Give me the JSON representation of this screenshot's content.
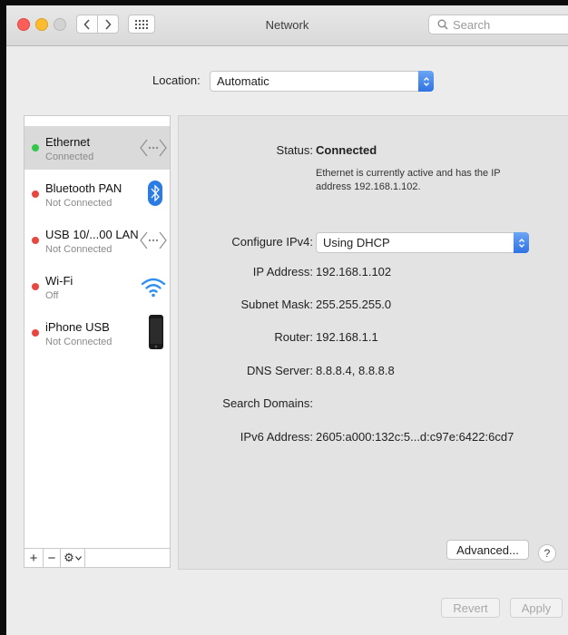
{
  "window": {
    "title": "Network"
  },
  "toolbar": {
    "search_placeholder": "Search"
  },
  "location": {
    "label": "Location:",
    "value": "Automatic"
  },
  "services": [
    {
      "name": "Ethernet",
      "status": "Connected",
      "dot": "green",
      "icon": "ethernet-icon",
      "selected": true
    },
    {
      "name": "Bluetooth PAN",
      "status": "Not Connected",
      "dot": "red",
      "icon": "bluetooth-icon",
      "selected": false
    },
    {
      "name": "USB 10/...00 LAN",
      "status": "Not Connected",
      "dot": "red",
      "icon": "usb-lan-icon",
      "selected": false
    },
    {
      "name": "Wi-Fi",
      "status": "Off",
      "dot": "red",
      "icon": "wifi-icon",
      "selected": false
    },
    {
      "name": "iPhone USB",
      "status": "Not Connected",
      "dot": "red",
      "icon": "iphone-icon",
      "selected": false
    }
  ],
  "sidebar_toolbar": {
    "add": "+",
    "remove": "−",
    "action": "⚙"
  },
  "details": {
    "status_label": "Status:",
    "status_value": "Connected",
    "status_description": "Ethernet is currently active and has the IP address 192.168.1.102.",
    "configure_label": "Configure IPv4:",
    "configure_value": "Using DHCP",
    "ip_label": "IP Address:",
    "ip_value": "192.168.1.102",
    "subnet_label": "Subnet Mask:",
    "subnet_value": "255.255.255.0",
    "router_label": "Router:",
    "router_value": "192.168.1.1",
    "dns_label": "DNS Server:",
    "dns_value": "8.8.8.4, 8.8.8.8",
    "search_domains_label": "Search Domains:",
    "search_domains_value": "",
    "ipv6_label": "IPv6 Address:",
    "ipv6_value": "2605:a000:132c:5...d:c97e:6422:6cd7"
  },
  "buttons": {
    "advanced": "Advanced...",
    "help": "?",
    "revert": "Revert",
    "apply": "Apply"
  },
  "colors": {
    "accent": "#3478f6",
    "connected": "#34c84a",
    "disconnected": "#e8473f"
  }
}
